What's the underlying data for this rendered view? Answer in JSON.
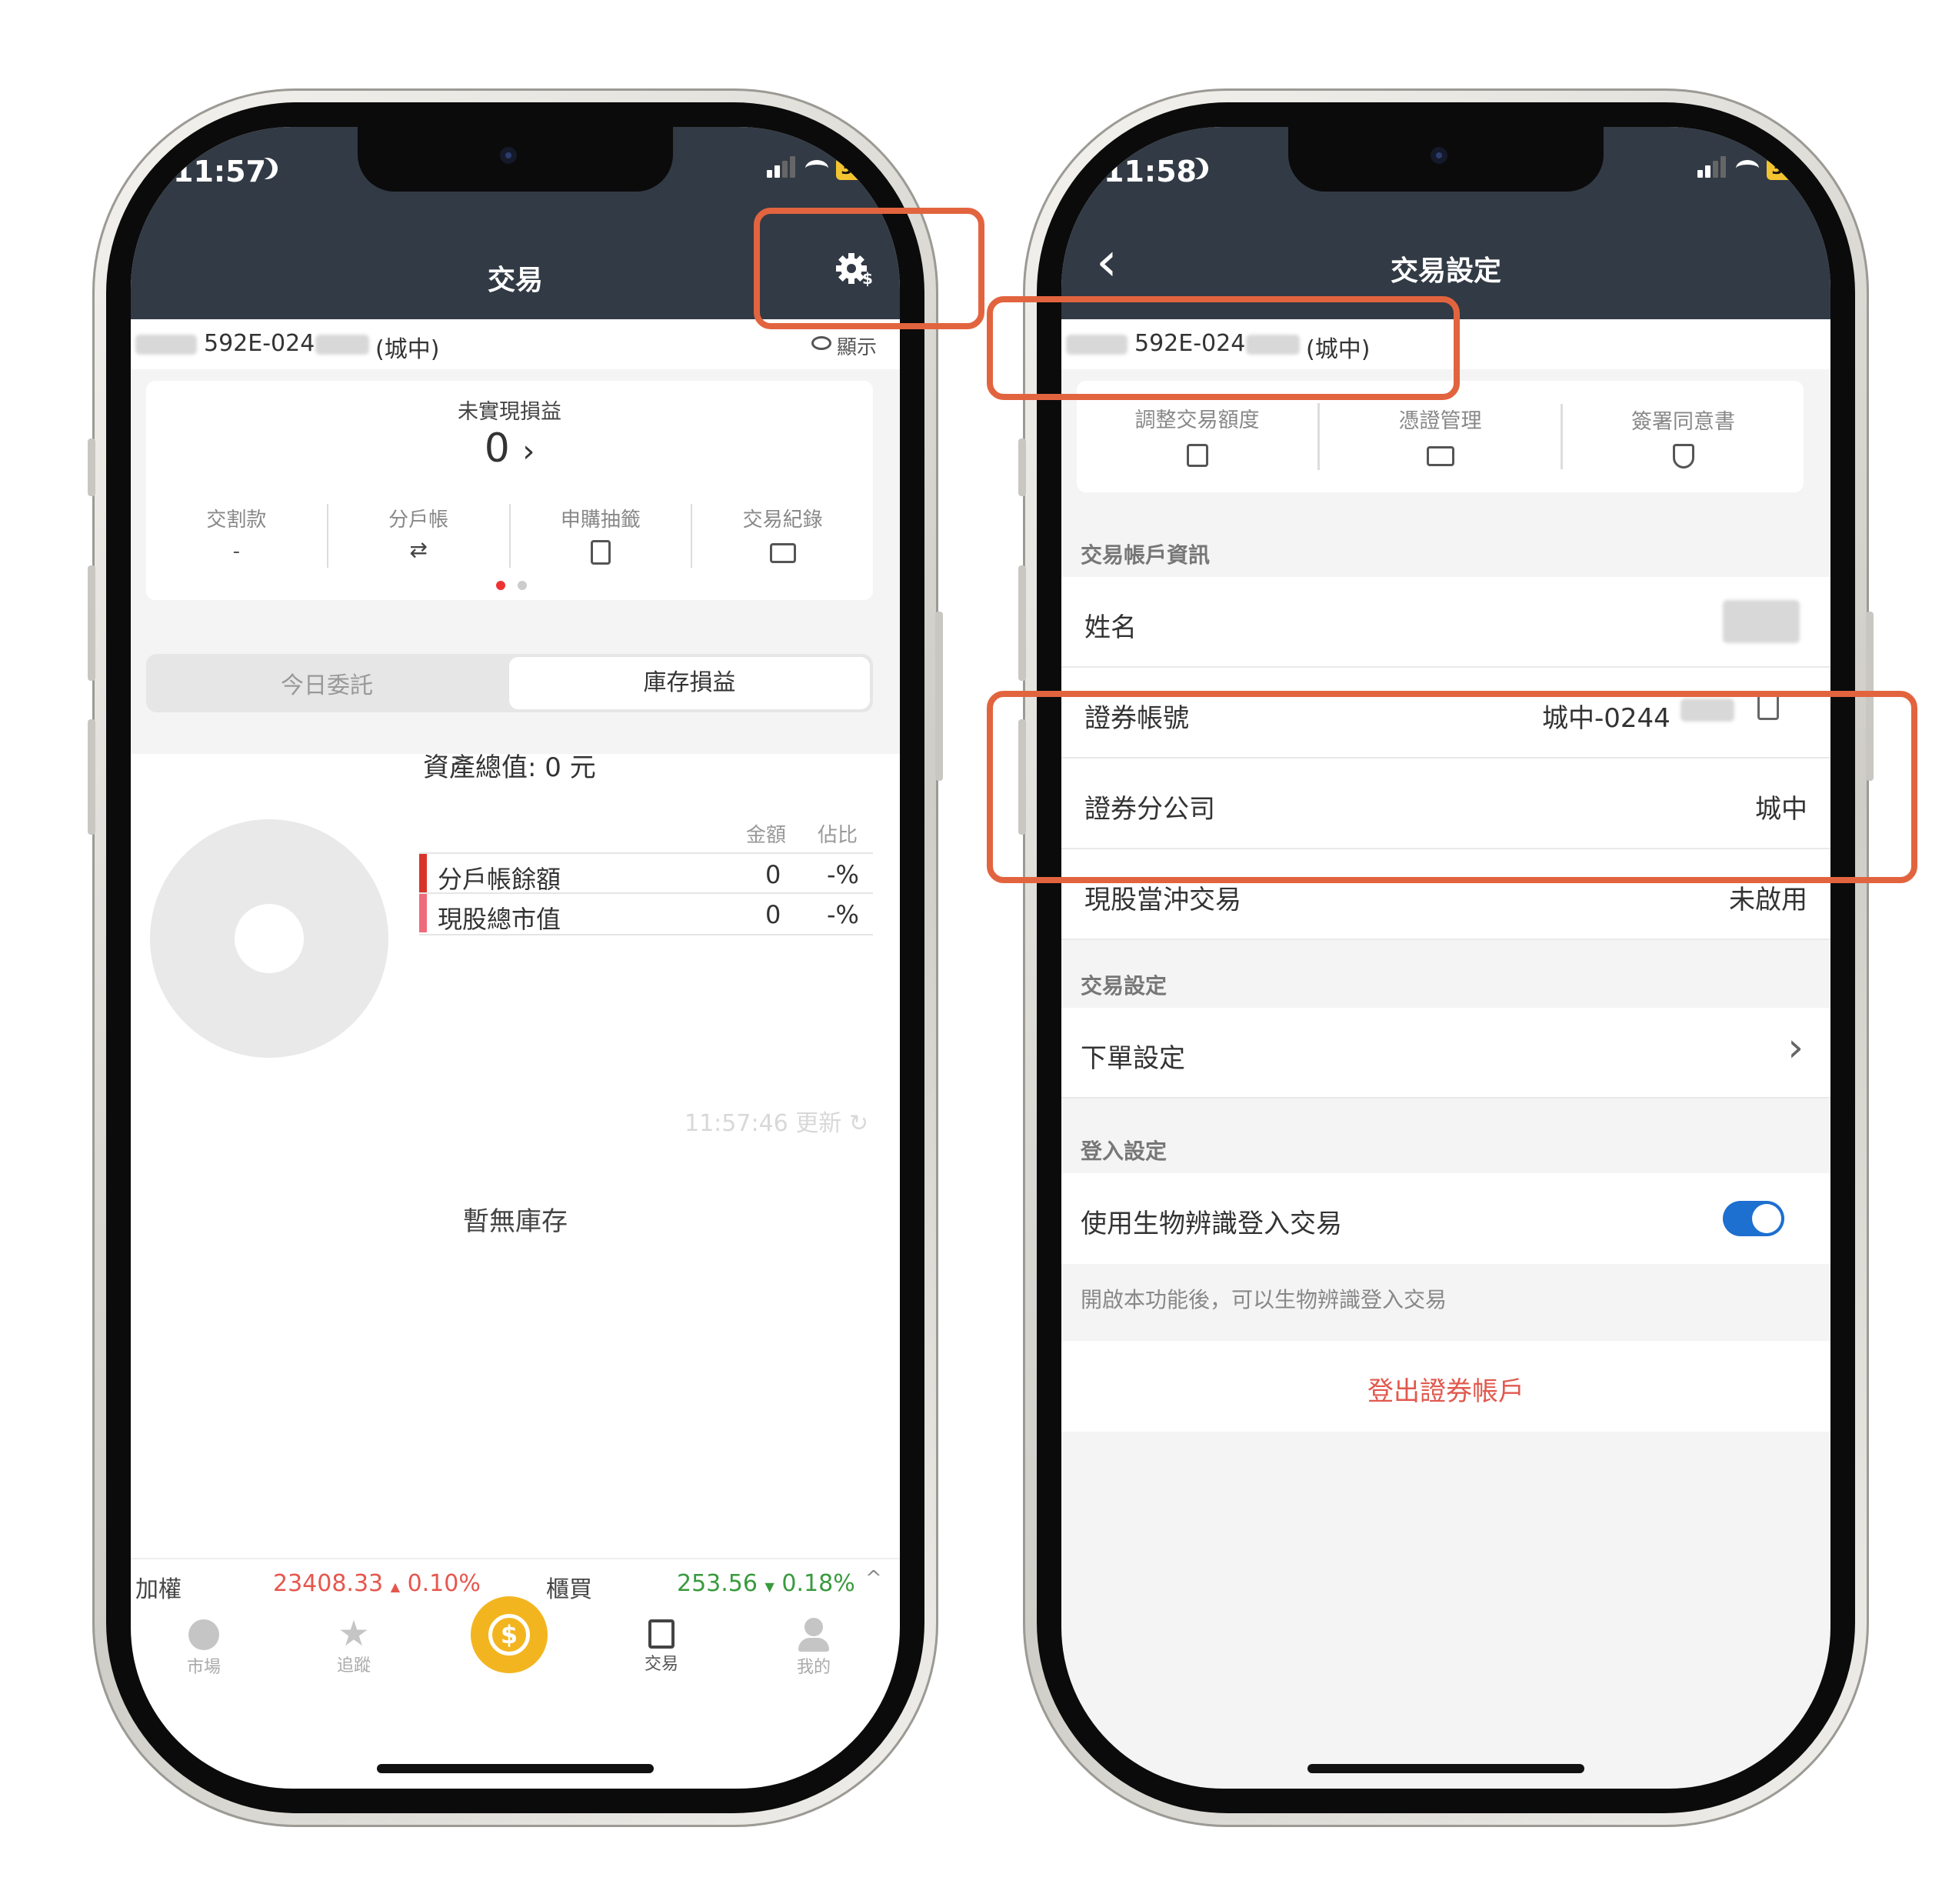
{
  "left": {
    "status": {
      "time": "11:57",
      "battery": "32"
    },
    "header": {
      "title": "交易"
    },
    "account": {
      "number": "592E-024",
      "branch": "(城中)",
      "show_label": "顯示"
    },
    "summary": {
      "unrealized_label": "未實現損益",
      "unrealized_value": "0",
      "arrow": "›",
      "items": [
        {
          "label": "交割款",
          "value": "-"
        },
        {
          "label": "分戶帳",
          "value": "⇄"
        },
        {
          "label": "申購抽籤"
        },
        {
          "label": "交易紀錄"
        }
      ]
    },
    "tabs": [
      {
        "label": "今日委託"
      },
      {
        "label": "庫存損益"
      }
    ],
    "assets": {
      "total": "資產總值: 0 元",
      "col_amount": "金額",
      "col_ratio": "佔比",
      "rows": [
        {
          "label": "分戶帳餘額",
          "amount": "0",
          "ratio": "-%",
          "color": "#d9342b"
        },
        {
          "label": "現股總市值",
          "amount": "0",
          "ratio": "-%",
          "color": "#ef6b7b"
        }
      ]
    },
    "update": {
      "time": "11:57:46",
      "label": "更新"
    },
    "empty": "暫無庫存",
    "ticker": [
      {
        "name": "加權",
        "value": "23408.33",
        "change": "0.10%",
        "dir": "▲",
        "color": "#e5574e"
      },
      {
        "name": "櫃買",
        "value": "253.56",
        "change": "0.18%",
        "dir": "▼",
        "color": "#3a9a3e"
      }
    ],
    "nav": [
      {
        "label": "市場"
      },
      {
        "label": "追蹤"
      },
      {
        "label": ""
      },
      {
        "label": "交易"
      },
      {
        "label": "我的"
      }
    ]
  },
  "right": {
    "status": {
      "time": "11:58",
      "battery": "32"
    },
    "header": {
      "title": "交易設定",
      "back": "‹"
    },
    "account": {
      "number": "592E-024",
      "branch": "(城中)"
    },
    "quick": [
      {
        "label": "調整交易額度"
      },
      {
        "label": "憑證管理"
      },
      {
        "label": "簽署同意書"
      }
    ],
    "sections": {
      "account_info": "交易帳戶資訊",
      "trade_settings": "交易設定",
      "login_settings": "登入設定"
    },
    "rows": {
      "name": {
        "label": "姓名"
      },
      "account_no": {
        "label": "證券帳號",
        "value": "城中-0244"
      },
      "branch": {
        "label": "證券分公司",
        "value": "城中"
      },
      "daytrade": {
        "label": "現股當沖交易",
        "value": "未啟用"
      },
      "order": {
        "label": "下單設定",
        "arrow": "›"
      },
      "biometric": {
        "label": "使用生物辨識登入交易",
        "enabled": true
      }
    },
    "biometric_note": "開啟本功能後，可以生物辨識登入交易",
    "logout": "登出證券帳戶"
  },
  "colors": {
    "header": "#323a45",
    "accent": "#e2643f",
    "coin": "#f3b51f",
    "toggle": "#1d6fd0",
    "logout": "#e2584d"
  }
}
